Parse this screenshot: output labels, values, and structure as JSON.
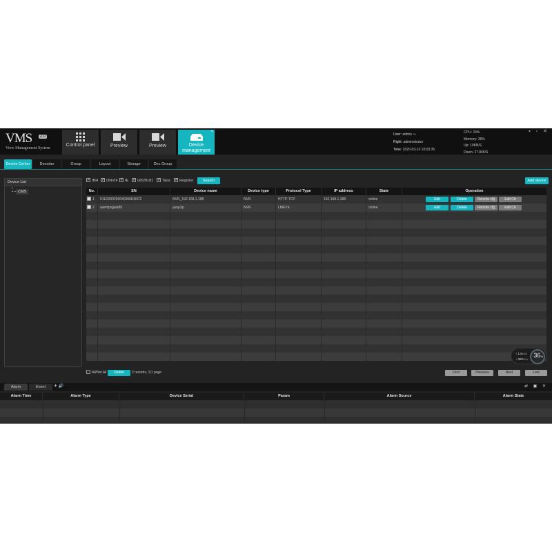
{
  "app": {
    "logo_text": "VMS",
    "logo_version": "2.0",
    "logo_subtitle": "View Management System"
  },
  "nav_tabs": [
    {
      "label": "Control panel",
      "icon": "grid-icon"
    },
    {
      "label": "Preview",
      "icon": "camera-icon"
    },
    {
      "label": "Preview",
      "icon": "camera-icon"
    },
    {
      "label": "Device management",
      "icon": "device-icon",
      "active": true,
      "close": "×"
    }
  ],
  "user": {
    "user_label": "User:",
    "user_value": "admin",
    "right_label": "Right:",
    "right_value": "administrator",
    "time_label": "Time:",
    "time_value": "2020-03-13 10:03:35"
  },
  "stats": {
    "cpu": "CPU: 24%",
    "memory": "Memory: 36%",
    "up": "Up: 10KB/S",
    "down": "Down: 271KB/S"
  },
  "window_controls": "▪ ▫ ✕",
  "sub_tabs": [
    "Device Center",
    "Decoder",
    "Group",
    "Layout",
    "Storage",
    "Dec Group"
  ],
  "device_list": {
    "title": "Device List",
    "root": "CMS"
  },
  "filters": [
    {
      "label": "IBH",
      "checked": true
    },
    {
      "label": "ONVIF",
      "checked": true
    },
    {
      "label": "IE",
      "checked": true
    },
    {
      "label": "GB28181",
      "checked": true
    },
    {
      "label": "Taos",
      "checked": true
    },
    {
      "label": "Register",
      "checked": true
    }
  ],
  "search_label": "Search",
  "add_device_label": "Add device",
  "table": {
    "columns": [
      "No.",
      "SN",
      "Device name",
      "Device type",
      "Protocol Type",
      "IP address",
      "State",
      "Operation"
    ],
    "rows": [
      {
        "no": "1",
        "sn": "01E2000200040906E96CF",
        "name": "NVR_192.168.1.188",
        "type": "NVR",
        "protocol": "HTTP-TCP",
        "ip": "192.168.1.188",
        "state": "online"
      },
      {
        "no": "2",
        "sn": "awmtpnjjalaff9",
        "name": "yunp2p",
        "type": "NVR",
        "protocol": "LMEYE",
        "ip": "",
        "state": "online"
      }
    ],
    "ops": [
      "Edit",
      "Delete",
      "Remote cfg",
      "Edit Ch"
    ]
  },
  "gauge": {
    "up_rate": "↑ 1.6",
    "up_unit": "KB/s",
    "down_rate": "↓ 322",
    "down_unit": "KB/s",
    "percent": "36",
    "percent_unit": "%"
  },
  "pager": {
    "select_all": "All/Not All",
    "delete_label": "Delete",
    "info": "2  records,   1/1  page",
    "first": "First",
    "previous": "Previous",
    "next": "Next",
    "last": "Last"
  },
  "alarm": {
    "tabs": [
      "Alarm",
      "Event"
    ],
    "icons_text": "✈ 🔊",
    "right_controls": "⇄ ▣ ✕",
    "columns": [
      "Alarm Time",
      "Alarm Type",
      "Device Serial",
      "Param",
      "Alarm Source",
      "Alarm State"
    ]
  },
  "colors": {
    "accent": "#15b6c0",
    "background": "#232323",
    "header": "#101010"
  }
}
